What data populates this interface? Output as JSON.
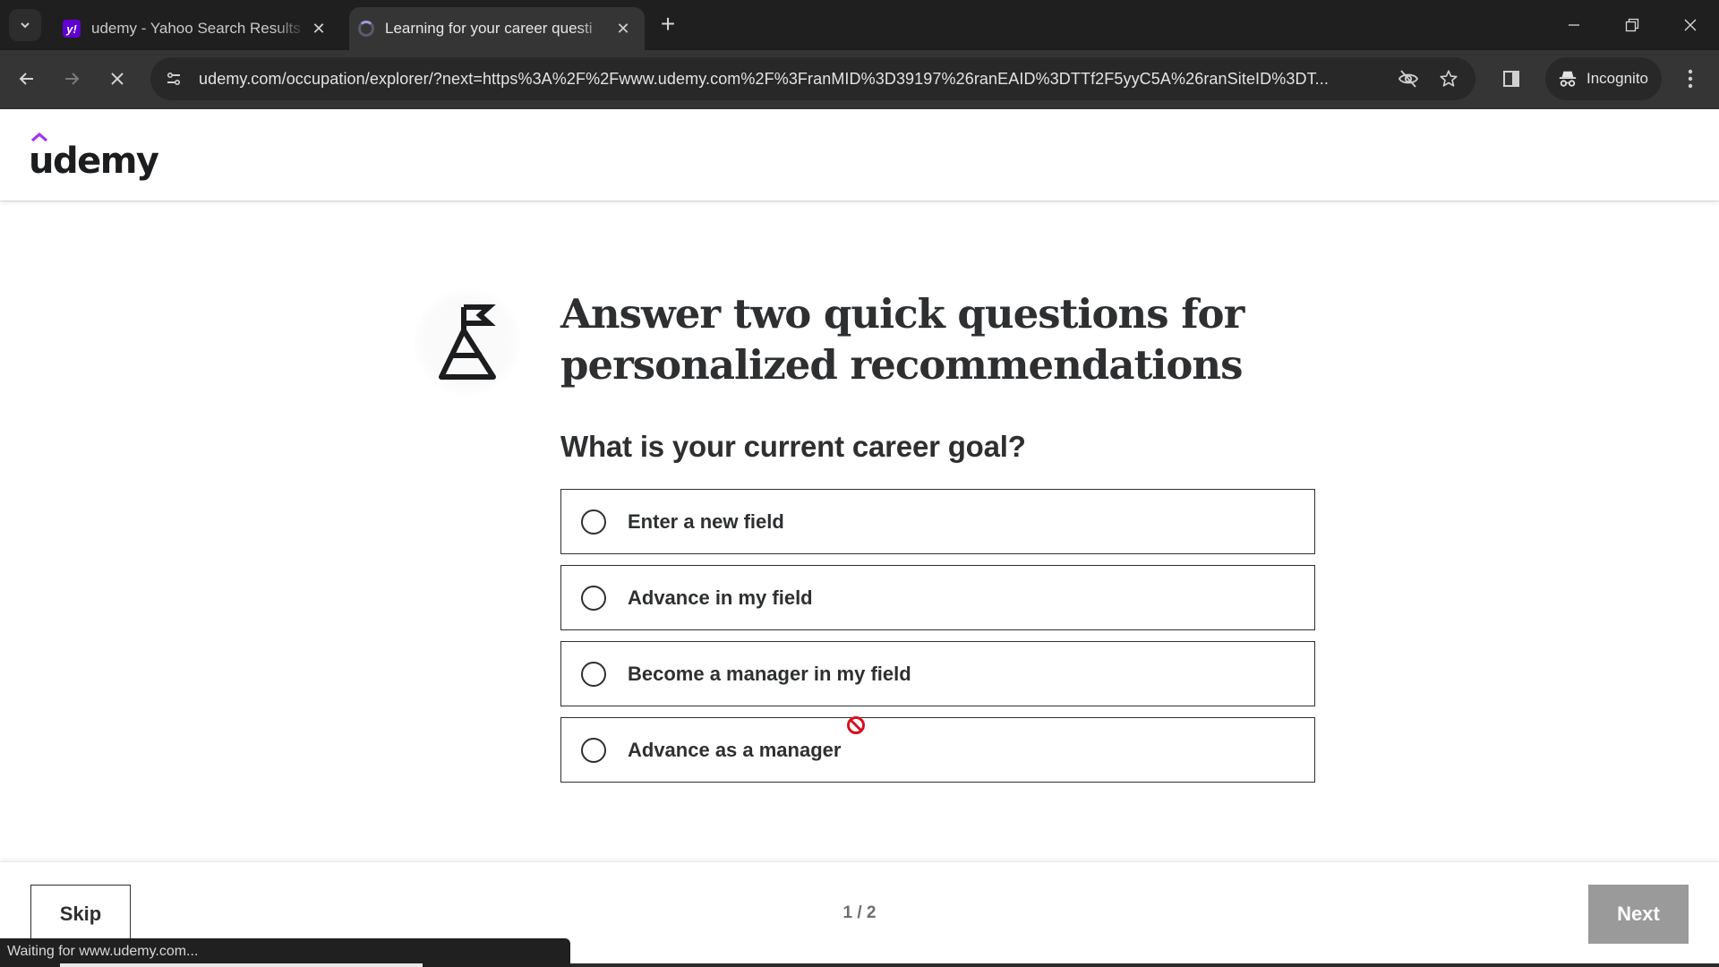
{
  "browser": {
    "tabs": [
      {
        "title": "udemy - Yahoo Search Results",
        "favicon": "yahoo-icon",
        "active": false
      },
      {
        "title": "Learning for your career questi",
        "favicon": "loading-spinner-icon",
        "active": true
      }
    ],
    "new_tab_label": "+",
    "url": "udemy.com/occupation/explorer/?next=https%3A%2F%2Fwww.udemy.com%2F%3FranMID%3D39197%26ranEAID%3DTTf2F5yyC5A%26ranSiteID%3DT...",
    "profile_label": "Incognito",
    "status_text": "Waiting for www.udemy.com..."
  },
  "site": {
    "logo_text": "udemy",
    "brand_color": "#a435f0"
  },
  "onboarding": {
    "headline": "Answer two quick questions for personalized recommendations",
    "question": "What is your current career goal?",
    "options": [
      {
        "label": "Enter a new field",
        "selected": false
      },
      {
        "label": "Advance in my field",
        "selected": false
      },
      {
        "label": "Become a manager in my field",
        "selected": false
      },
      {
        "label": "Advance as a manager",
        "selected": false
      }
    ],
    "skip_label": "Skip",
    "pager_text": "1 / 2",
    "next_label": "Next",
    "next_disabled": true
  }
}
